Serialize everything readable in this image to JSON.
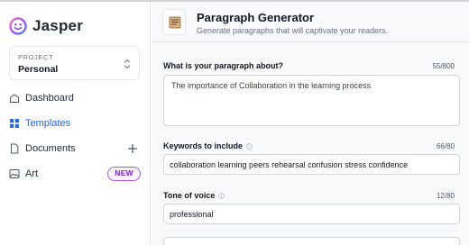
{
  "app": {
    "name": "Jasper"
  },
  "sidebar": {
    "project_label": "PROJECT",
    "project_name": "Personal",
    "items": [
      {
        "label": "Dashboard",
        "icon": "home-icon"
      },
      {
        "label": "Templates",
        "icon": "grid-icon",
        "active": true
      },
      {
        "label": "Documents",
        "icon": "document-icon",
        "action_icon": "plus-icon"
      },
      {
        "label": "Art",
        "icon": "image-icon",
        "badge": "NEW"
      }
    ]
  },
  "header": {
    "icon": "paragraph-icon",
    "title": "Paragraph Generator",
    "subtitle": "Generate paragraphs that will captivate your readers."
  },
  "form": {
    "about": {
      "label": "What is your paragraph about?",
      "counter": "55/800",
      "value": "The importance of Collaboration in the learning process"
    },
    "keywords": {
      "label": "Keywords to include",
      "counter": "66/80",
      "value": "collaboration learning peers rehearsal confusion stress confidence"
    },
    "tone": {
      "label": "Tone of voice",
      "counter": "12/80",
      "value": "professional"
    }
  },
  "colors": {
    "accent": "#2563eb",
    "badge_border": "#a855f7",
    "badge_text": "#7e22ce"
  }
}
